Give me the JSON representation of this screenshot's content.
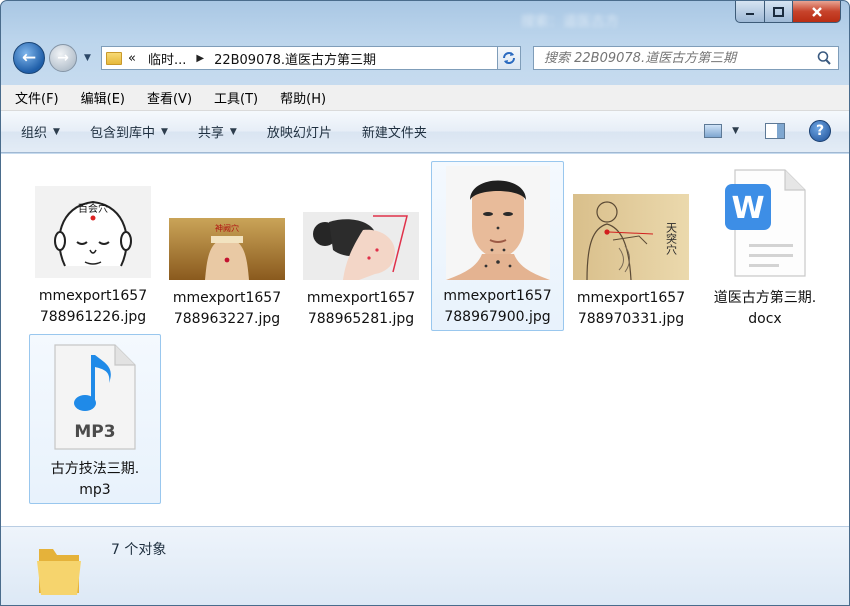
{
  "window": {
    "blurred_title": "搜索：道医古方"
  },
  "nav": {
    "back_glyph": "←",
    "forward_glyph": "→",
    "breadcrumb": [
      "«",
      "临时...",
      "22B09078.道医古方第三期"
    ],
    "search_placeholder": "搜索 22B09078.道医古方第三期"
  },
  "menu": [
    "文件(F)",
    "编辑(E)",
    "查看(V)",
    "工具(T)",
    "帮助(H)"
  ],
  "toolbar": {
    "organize": "组织",
    "include_library": "包含到库中",
    "share": "共享",
    "slideshow": "放映幻灯片",
    "new_folder": "新建文件夹"
  },
  "files": [
    {
      "name_line1": "mmexport1657",
      "name_line2": "788961226.jpg",
      "kind": "image",
      "thumb_caption": "百会穴"
    },
    {
      "name_line1": "mmexport1657",
      "name_line2": "788963227.jpg",
      "kind": "image",
      "thumb_caption": "神阙穴"
    },
    {
      "name_line1": "mmexport1657",
      "name_line2": "788965281.jpg",
      "kind": "image",
      "thumb_caption": ""
    },
    {
      "name_line1": "mmexport1657",
      "name_line2": "788967900.jpg",
      "kind": "image",
      "thumb_caption": ""
    },
    {
      "name_line1": "mmexport1657",
      "name_line2": "788970331.jpg",
      "kind": "image",
      "thumb_caption": "天突穴"
    },
    {
      "name_line1": "道医古方第三期.",
      "name_line2": "docx",
      "kind": "docx",
      "thumb_caption": "W"
    },
    {
      "name_line1": "古方技法三期.",
      "name_line2": "mp3",
      "kind": "mp3",
      "thumb_caption": "MP3"
    }
  ],
  "status": {
    "count_text": "7 个对象"
  },
  "colors": {
    "accent": "#3d8ee6",
    "selection_border": "#99c7ee"
  }
}
